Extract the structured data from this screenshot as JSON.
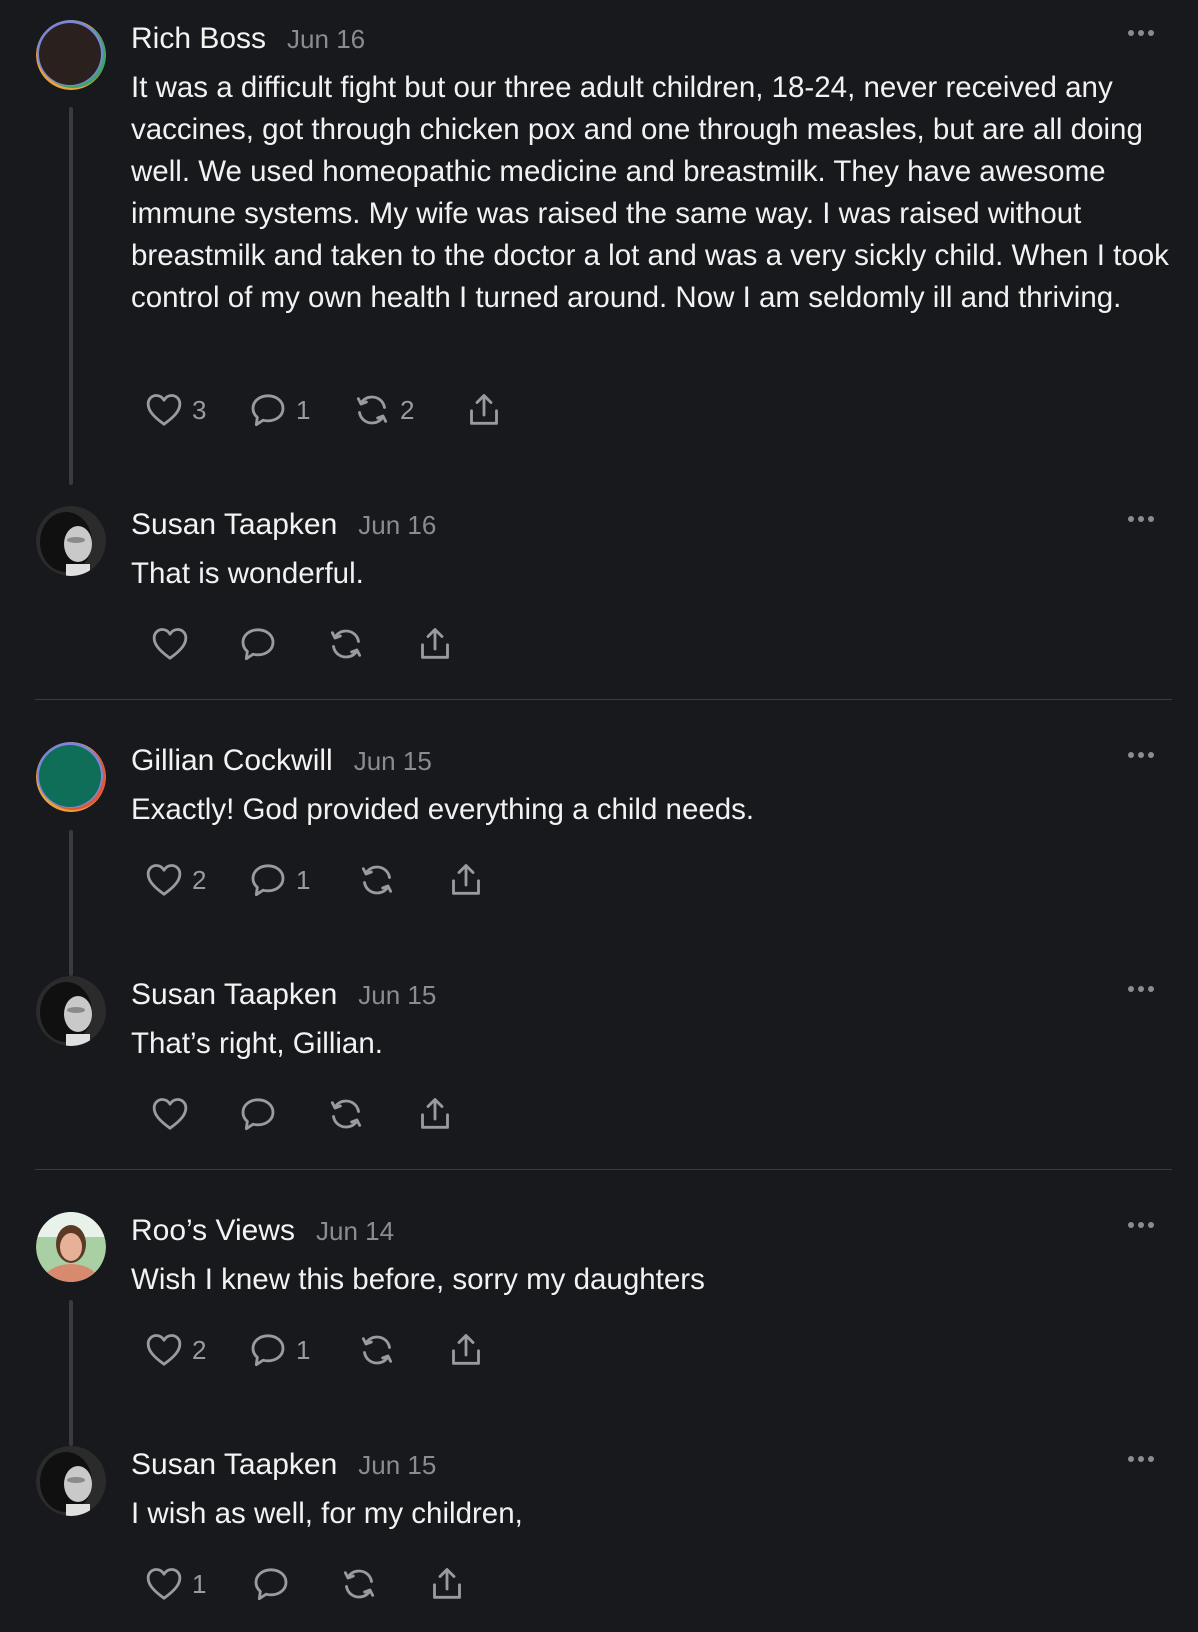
{
  "posts": [
    {
      "author": "Rich Boss",
      "date": "Jun 16",
      "avatar": "avatar-dark-gradient-ring",
      "text": "It was a difficult fight but our three adult children, 18-24, never received any vaccines, got through chicken pox and one through measles, but are all doing well. We used homeopathic medicine and breastmilk. They have awesome immune systems. My wife was raised the same way. I was raised without breastmilk and taken to the doctor a lot and was a very sickly child. When I took control of my own health I turned around. Now I am seldomly ill and thriving.",
      "likes": "3",
      "replies": "1",
      "reposts": "2"
    },
    {
      "author": "Susan Taapken",
      "date": "Jun 16",
      "avatar": "avatar-grayscale-photo",
      "text": "That is wonderful.",
      "likes": "",
      "replies": "",
      "reposts": ""
    },
    {
      "author": "Gillian Cockwill",
      "date": "Jun 15",
      "avatar": "avatar-green-gradient-ring",
      "text": "Exactly! God provided everything a child needs.",
      "likes": "2",
      "replies": "1",
      "reposts": ""
    },
    {
      "author": "Susan Taapken",
      "date": "Jun 15",
      "avatar": "avatar-grayscale-photo",
      "text": "That’s right, Gillian.",
      "likes": "",
      "replies": "",
      "reposts": ""
    },
    {
      "author": "Roo’s Views",
      "date": "Jun 14",
      "avatar": "avatar-color-photo",
      "text": "Wish I knew this before, sorry my daughters",
      "likes": "2",
      "replies": "1",
      "reposts": ""
    },
    {
      "author": "Susan Taapken",
      "date": "Jun 15",
      "avatar": "avatar-grayscale-photo",
      "text": "I wish as well, for my children,",
      "likes": "1",
      "replies": "",
      "reposts": ""
    }
  ],
  "icons": {
    "like": "heart-icon",
    "reply": "comment-icon",
    "repost": "repost-icon",
    "share": "share-icon",
    "more": "more-dots-icon"
  },
  "colors": {
    "background": "#18191c",
    "text": "#f2f2f2",
    "muted": "#8b8c90",
    "divider": "#3b3c40"
  }
}
